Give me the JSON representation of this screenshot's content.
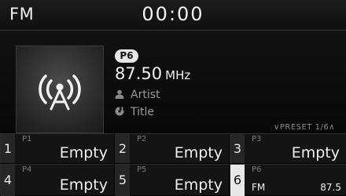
{
  "status": {
    "mode": "FM",
    "time": "00:00"
  },
  "station": {
    "preset_badge": "P6",
    "frequency": "87.50",
    "unit": "MHz",
    "artist": "Artist",
    "title": "Title",
    "art_icon": "radio-broadcast-icon"
  },
  "preset_page_label": "∨PRESET 1/6∧",
  "presets": [
    {
      "number": "1",
      "slot": "P1",
      "name": "Empty"
    },
    {
      "number": "2",
      "slot": "P2",
      "name": "Empty"
    },
    {
      "number": "3",
      "slot": "P3",
      "name": "Empty"
    },
    {
      "number": "4",
      "slot": "P4",
      "name": "Empty"
    },
    {
      "number": "5",
      "slot": "P5",
      "name": "Empty"
    },
    {
      "number": "6",
      "slot": "P6",
      "band": "FM",
      "frequency": "87.5",
      "selected": true
    }
  ]
}
